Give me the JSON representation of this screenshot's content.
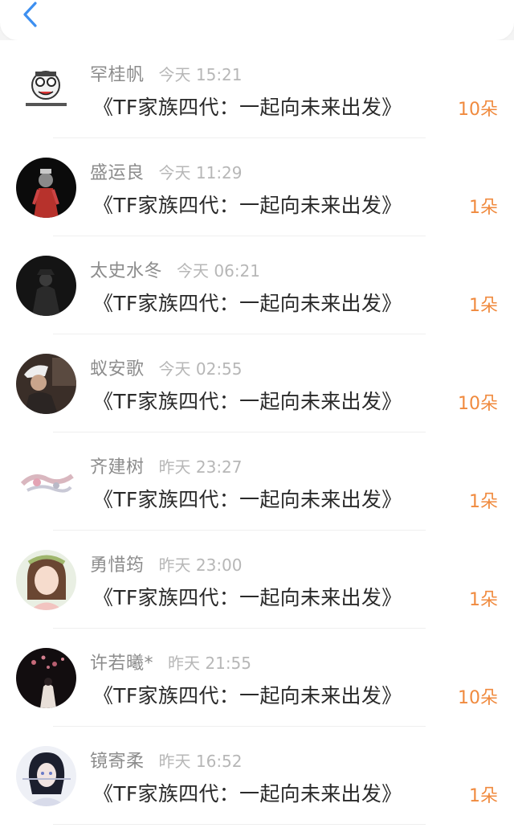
{
  "header": {
    "back_icon": "chevron-left-icon",
    "accent": "#3d8ff0"
  },
  "gift_color": "#f08a3e",
  "entries": [
    {
      "name": "罕桂帆",
      "time": "今天 15:21",
      "title": "《TF家族四代：一起向未来出发》",
      "count": "10朵"
    },
    {
      "name": "盛运良",
      "time": "今天 11:29",
      "title": "《TF家族四代：一起向未来出发》",
      "count": "1朵"
    },
    {
      "name": "太史水冬",
      "time": "今天 06:21",
      "title": "《TF家族四代：一起向未来出发》",
      "count": "1朵"
    },
    {
      "name": "蚁安歌",
      "time": "今天 02:55",
      "title": "《TF家族四代：一起向未来出发》",
      "count": "10朵"
    },
    {
      "name": "齐建树",
      "time": "昨天 23:27",
      "title": "《TF家族四代：一起向未来出发》",
      "count": "1朵"
    },
    {
      "name": "勇惜筠",
      "time": "昨天 23:00",
      "title": "《TF家族四代：一起向未来出发》",
      "count": "1朵"
    },
    {
      "name": "许若曦*",
      "time": "昨天 21:55",
      "title": "《TF家族四代：一起向未来出发》",
      "count": "10朵"
    },
    {
      "name": "镜寄柔",
      "time": "昨天 16:52",
      "title": "《TF家族四代：一起向未来出发》",
      "count": "1朵"
    }
  ]
}
